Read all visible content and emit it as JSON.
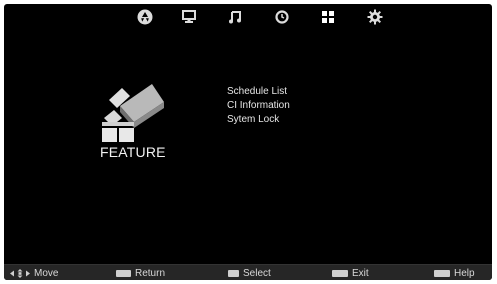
{
  "topbar": {
    "icons": [
      {
        "name": "picture-icon"
      },
      {
        "name": "display-icon"
      },
      {
        "name": "music-icon"
      },
      {
        "name": "clock-icon"
      },
      {
        "name": "feature-grid-icon"
      },
      {
        "name": "settings-gear-icon"
      }
    ],
    "selected_icon": "feature-grid-icon"
  },
  "feature": {
    "title": "FEATURE",
    "items": [
      {
        "label": "Schedule List"
      },
      {
        "label": "CI Information"
      },
      {
        "label": "Sytem Lock"
      }
    ]
  },
  "bottombar": {
    "move_label": "Move",
    "return_label": "Return",
    "select_label": "Select",
    "exit_label": "Exit",
    "help_label": "Help"
  },
  "colors": {
    "screen_background": "#000000",
    "bottom_bar": "#262626",
    "text": "#e6e6e6",
    "icon": "#d9d9d9"
  }
}
